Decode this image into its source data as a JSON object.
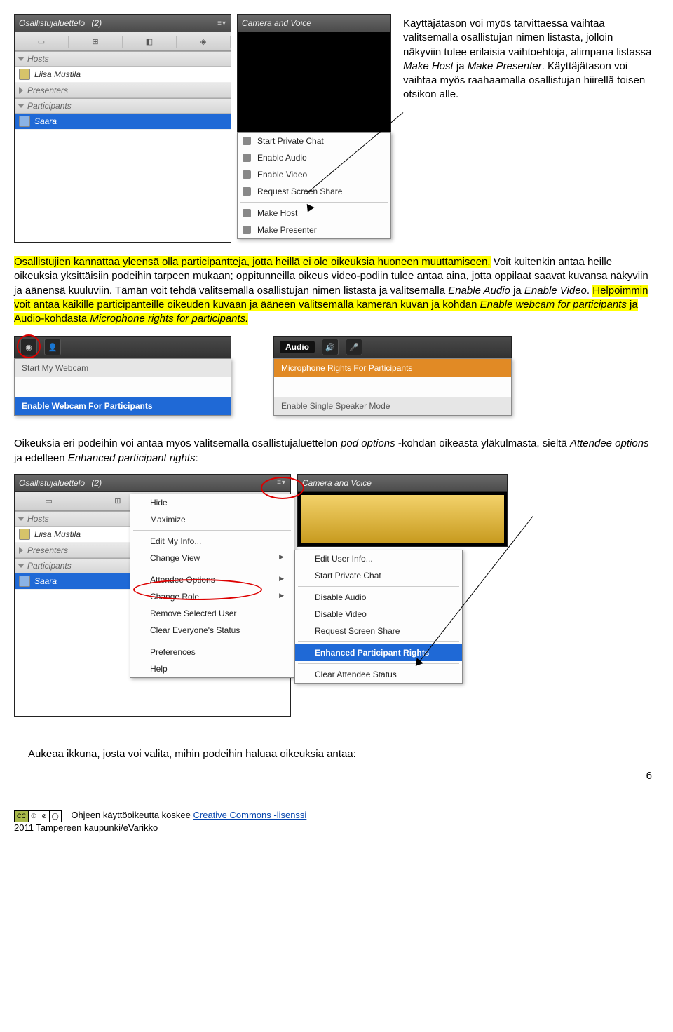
{
  "para1_a": "Käyttäjätason voi myös tarvittaessa vaihtaa valitsemalla osallistujan nimen listasta, jolloin näkyviin tulee erilaisia vaihtoehtoja, alimpana listassa ",
  "para1_make_host": "Make Host",
  "para1_ja": " ja ",
  "para1_make_presenter": "Make Presenter",
  "para1_b": ". Käyttäjätason voi vaihtaa myös raahaamalla osallistujan hiirellä toisen otsikon alle.",
  "para2_hl1": "Osallistujien kannattaa yleensä olla participantteja, jotta heillä ei ole oikeuksia huoneen muuttamiseen.",
  "para2_mid": " Voit kuitenkin antaa heille oikeuksia yksittäisiin podeihin tarpeen mukaan; oppitunneilla oikeus video-podiin tulee antaa aina, jotta oppilaat saavat kuvansa näkyviin ja äänensä kuuluviin. Tämän voit tehdä valitsemalla osallistujan nimen listasta ja valitsemalla ",
  "para2_ea": "Enable Audio",
  "para2_ja": " ja ",
  "para2_ev": "Enable Video",
  "para2_dot": ". ",
  "para2_hl2a": "Helpoimmin voit antaa kaikille participanteille oikeuden kuvaan ja ääneen valitsemalla kameran kuvan ja kohdan ",
  "para2_hl2b": "Enable webcam for participants",
  "para2_hl2c": " ja Audio-kohdasta ",
  "para2_hl2d": "Microphone rights for participants.",
  "para3_a": "Oikeuksia eri podeihin voi antaa myös valitsemalla osallistujaluettelon ",
  "para3_po": "pod options",
  "para3_b": " -kohdan oikeasta yläkulmasta, sieltä ",
  "para3_ao": "Attendee options",
  "para3_c": " ja edelleen ",
  "para3_epr": "Enhanced participant rights",
  "para3_d": ":",
  "para4": "Aukeaa ikkuna, josta voi valita, mihin podeihin haluaa oikeuksia antaa:",
  "podTitle": "Osallistujaluettelo",
  "podCount": "(2)",
  "camTitle": "Camera and Voice",
  "hosts": "Hosts",
  "hostName": "Liisa Mustila",
  "presenters": "Presenters",
  "participants": "Participants",
  "partName": "Saara",
  "ctx1": {
    "spc": "Start Private Chat",
    "ea": "Enable Audio",
    "ev": "Enable Video",
    "rss": "Request Screen Share",
    "mh": "Make Host",
    "mp": "Make Presenter"
  },
  "webcam": {
    "smw": "Start My Webcam",
    "ewfp": "Enable Webcam For Participants"
  },
  "audio": {
    "label": "Audio",
    "mrfp": "Microphone Rights For Participants",
    "essm": "Enable Single Speaker Mode"
  },
  "ctx2": {
    "hide": "Hide",
    "max": "Maximize",
    "emi": "Edit My Info...",
    "cv": "Change View",
    "ao": "Attendee Options",
    "cr": "Change Role",
    "rsu": "Remove Selected User",
    "ces": "Clear Everyone's Status",
    "pref": "Preferences",
    "help": "Help"
  },
  "ctx3": {
    "eui": "Edit User Info...",
    "spc": "Start Private Chat",
    "da": "Disable Audio",
    "dv": "Disable Video",
    "rss": "Request Screen Share",
    "epr": "Enhanced Participant Rights",
    "cas": "Clear Attendee Status"
  },
  "footer_prefix": "Ohjeen käyttöoikeutta koskee ",
  "footer_link": "Creative Commons -lisenssi",
  "footer_line2": "2011 Tampereen kaupunki/eVarikko",
  "pagenum": "6"
}
